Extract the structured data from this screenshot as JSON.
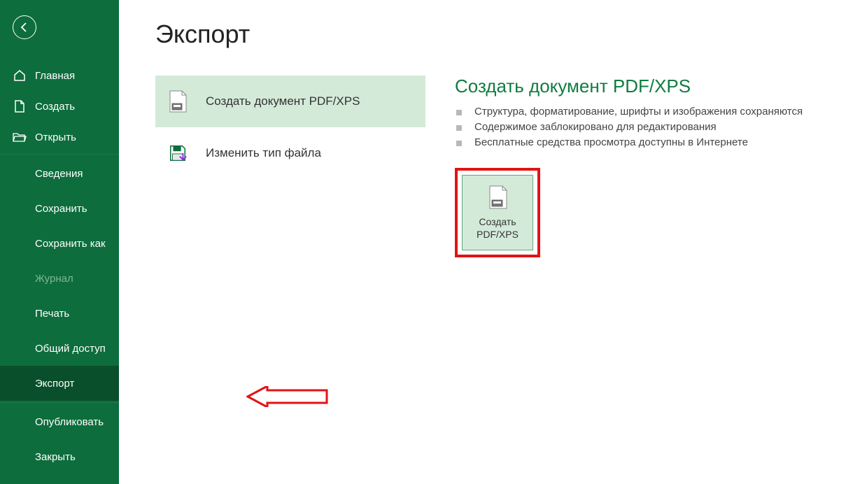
{
  "sidebar": {
    "home": "Главная",
    "new": "Создать",
    "open": "Открыть",
    "info": "Сведения",
    "save": "Сохранить",
    "saveas": "Сохранить как",
    "history": "Журнал",
    "print": "Печать",
    "share": "Общий доступ",
    "export": "Экспорт",
    "publish": "Опубликовать",
    "close": "Закрыть"
  },
  "page": {
    "title": "Экспорт"
  },
  "options": {
    "pdfxps": "Создать документ PDF/XPS",
    "changetype": "Изменить тип файла"
  },
  "detail": {
    "title": "Создать документ PDF/XPS",
    "b1": "Структура, форматирование, шрифты и изображения сохраняются",
    "b2": "Содержимое заблокировано для редактирования",
    "b3": "Бесплатные средства просмотра доступны в Интернете",
    "button_l1": "Создать",
    "button_l2": "PDF/XPS"
  }
}
